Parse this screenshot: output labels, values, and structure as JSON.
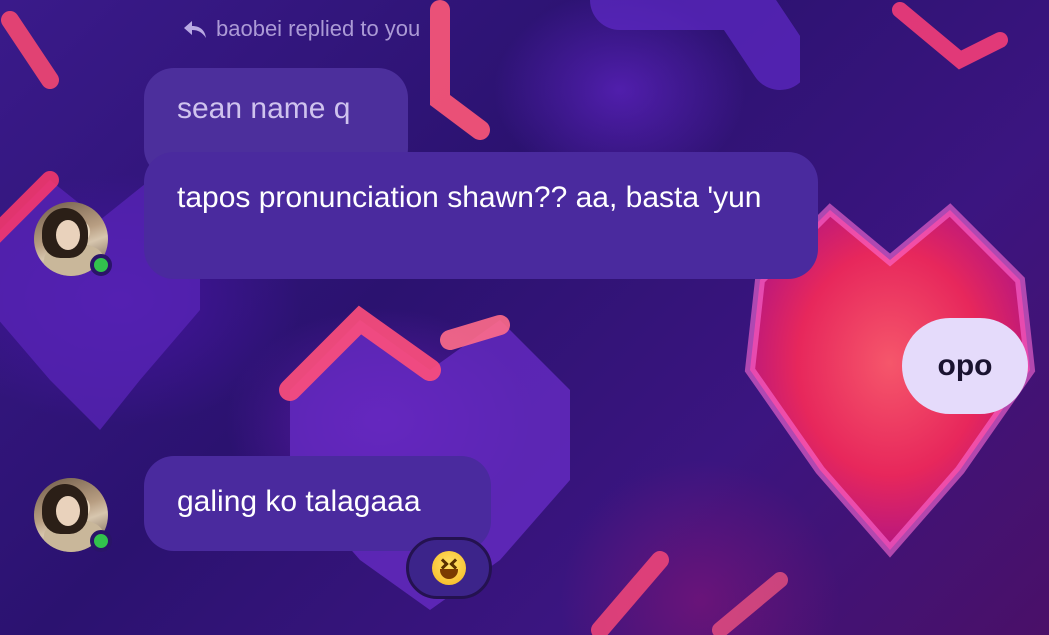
{
  "reply_header": {
    "text": "baobei replied to you",
    "icon": "reply-arrow-icon"
  },
  "quoted_message": {
    "text": "sean name q"
  },
  "messages": [
    {
      "sender": "contact",
      "text": "tapos pronunciation shawn?? aa, basta 'yun"
    },
    {
      "sender": "me",
      "text": "opo"
    },
    {
      "sender": "contact",
      "text": "galing ko talagaaa"
    }
  ],
  "reaction": {
    "emoji": "grinning-squinting-face",
    "icon": "laughing-emoji-icon"
  },
  "contact": {
    "avatar": "avatar-photo",
    "status": "online"
  },
  "colors": {
    "incoming_bubble": "#4a2a9e",
    "outgoing_bubble": "#e5dbfb",
    "online": "#32c24d",
    "background": "#2a0f5e"
  }
}
